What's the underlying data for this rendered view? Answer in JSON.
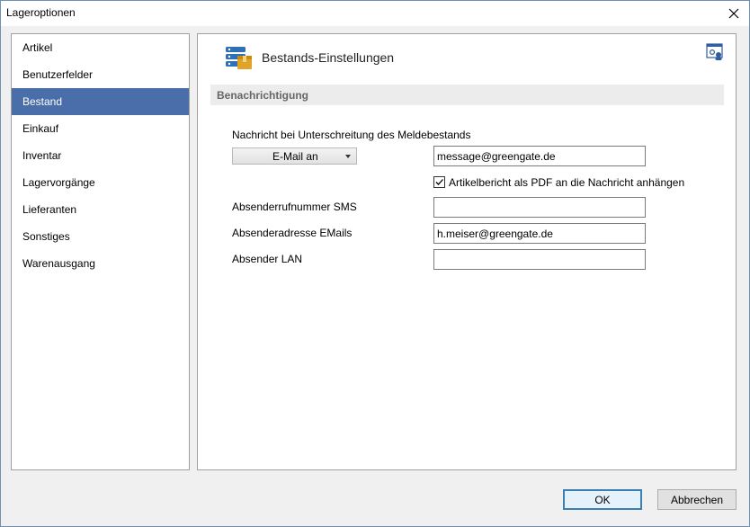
{
  "window": {
    "title": "Lageroptionen",
    "close_icon": "close-icon"
  },
  "nav": {
    "items": [
      {
        "label": "Artikel",
        "selected": false
      },
      {
        "label": "Benutzerfelder",
        "selected": false
      },
      {
        "label": "Bestand",
        "selected": true
      },
      {
        "label": "Einkauf",
        "selected": false
      },
      {
        "label": "Inventar",
        "selected": false
      },
      {
        "label": "Lagervorgänge",
        "selected": false
      },
      {
        "label": "Lieferanten",
        "selected": false
      },
      {
        "label": "Sonstiges",
        "selected": false
      },
      {
        "label": "Warenausgang",
        "selected": false
      }
    ]
  },
  "content": {
    "header_title": "Bestands-Einstellungen",
    "header_icon": "inventory-settings-icon",
    "help_icon": "settings-help-icon",
    "section_title": "Benachrichtigung",
    "notification_label": "Nachricht bei Unterschreitung des Meldebestands",
    "notification_method": "E-Mail an",
    "notification_email": "message@greengate.de",
    "attach_pdf_label": "Artikelbericht als PDF an die Nachricht anhängen",
    "attach_pdf_checked": true,
    "sms_sender_label": "Absenderrufnummer SMS",
    "sms_sender_value": "",
    "email_sender_label": "Absenderadresse EMails",
    "email_sender_value": "h.meiser@greengate.de",
    "lan_sender_label": "Absender LAN",
    "lan_sender_value": ""
  },
  "buttons": {
    "ok": "OK",
    "cancel": "Abbrechen"
  },
  "colors": {
    "selected_nav": "#4a6ea9",
    "primary_border": "#3c7fb1"
  }
}
